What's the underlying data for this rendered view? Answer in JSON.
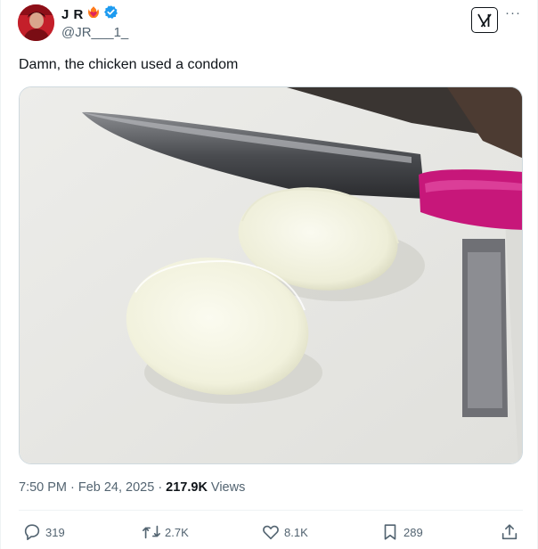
{
  "author": {
    "display_name": "J R",
    "handle": "@JR___1_",
    "verified": true,
    "emoji_badge": "heart-on-fire",
    "avatar_color": "#b51c25"
  },
  "header": {
    "grok_icon": "grok-icon",
    "more_label": "···"
  },
  "tweet": {
    "text": "Damn, the chicken used a condom",
    "image_icon": "photo-boiled-egg-halves-knife"
  },
  "meta": {
    "time": "7:50 PM",
    "date": "Feb 24, 2025",
    "views_count": "217.9K",
    "views_label": "Views"
  },
  "actions": {
    "replies": "319",
    "retweets": "2.7K",
    "likes": "8.1K",
    "bookmarks": "289"
  },
  "colors": {
    "text": "#0f1419",
    "secondary": "#536471",
    "verified": "#1d9bf0",
    "divider": "#eff3f4"
  }
}
